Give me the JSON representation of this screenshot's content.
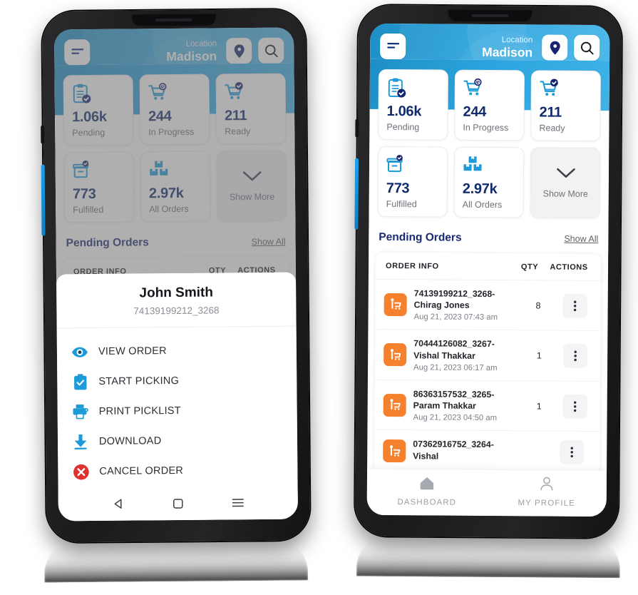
{
  "app": {
    "header": {
      "menu_icon": "hamburger-menu-icon",
      "location_label": "Location",
      "location_value": "Madison",
      "pin_icon": "map-pin-icon",
      "search_icon": "search-icon"
    },
    "stats": [
      {
        "value": "1.06k",
        "label": "Pending",
        "icon": "clipboard-check-icon"
      },
      {
        "value": "244",
        "label": "In Progress",
        "icon": "cart-clock-icon"
      },
      {
        "value": "211",
        "label": "Ready",
        "icon": "cart-check-icon"
      },
      {
        "value": "773",
        "label": "Fulfilled",
        "icon": "box-check-icon"
      },
      {
        "value": "2.97k",
        "label": "All Orders",
        "icon": "boxes-icon"
      }
    ],
    "show_more": {
      "label": "Show More",
      "icon": "chevron-down-icon"
    },
    "section": {
      "title": "Pending Orders",
      "show_all": "Show All"
    },
    "table": {
      "headers": {
        "info": "ORDER INFO",
        "qty": "QTY",
        "actions": "ACTIONS"
      },
      "row_icon": "shopper-cart-icon",
      "kebab_icon": "more-vertical-icon",
      "rows": [
        {
          "title": "74139199212_3268-Chirag Jones",
          "date": "Aug 21, 2023 07:43 am",
          "qty": "8"
        },
        {
          "title": "70444126082_3267-Vishal Thakkar",
          "date": "Aug 21, 2023 06:17 am",
          "qty": "1"
        },
        {
          "title": "86363157532_3265-Param Thakkar",
          "date": "Aug 21, 2023 04:50 am",
          "qty": "1"
        },
        {
          "title": "07362916752_3264-Vishal",
          "date": "",
          "qty": ""
        }
      ]
    },
    "bottom_nav": [
      {
        "label": "DASHBOARD",
        "icon": "home-icon"
      },
      {
        "label": "MY PROFILE",
        "icon": "person-icon"
      }
    ],
    "android_nav": {
      "back": "triangle-back-icon",
      "home": "square-home-icon",
      "recents": "hamburger-recents-icon"
    }
  },
  "action_sheet": {
    "name": "John Smith",
    "order_id": "74139199212_3268",
    "items": [
      {
        "label": "VIEW ORDER",
        "icon": "eye-icon",
        "color": "#1c9bd8"
      },
      {
        "label": "START PICKING",
        "icon": "clipboard-check-icon",
        "color": "#1c9bd8"
      },
      {
        "label": "PRINT PICKLIST",
        "icon": "printer-icon",
        "color": "#1c9bd8"
      },
      {
        "label": "DOWNLOAD",
        "icon": "download-icon",
        "color": "#1c9bd8"
      },
      {
        "label": "CANCEL ORDER",
        "icon": "cancel-circle-icon",
        "color": "#e03131"
      }
    ]
  },
  "colors": {
    "header_blue_start": "#1e8fc6",
    "header_blue_end": "#3fb3e8",
    "navy": "#102a6b",
    "accent_blue": "#1c9bd8",
    "order_badge_orange": "#f5812f",
    "cancel_red": "#e03131"
  }
}
